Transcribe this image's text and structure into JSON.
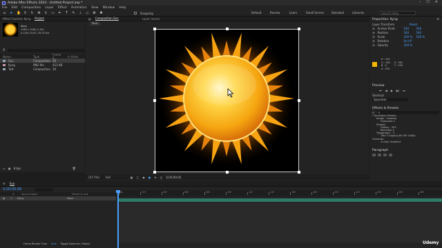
{
  "app": {
    "title": "Adobe After Effects 2024 - Untitled Project.aep *",
    "window_controls": [
      "–",
      "☐",
      "✕"
    ]
  },
  "menu": [
    "File",
    "Edit",
    "Composition",
    "Layer",
    "Effect",
    "Animation",
    "View",
    "Window",
    "Help"
  ],
  "workspaces": [
    "Default",
    "Review",
    "Learn",
    "Small Screen",
    "Standard",
    "Libraries"
  ],
  "search_placeholder": "Search Help",
  "left_panel": {
    "tabs": [
      "Effect Controls Kyng",
      "Project"
    ],
    "footage": {
      "name": "Kyng",
      "line1": "1080 x 1080 (1.00)",
      "line2": "Δ 0;00;10;00, 30.00 fps"
    },
    "search": "",
    "columns": [
      "Name",
      "Type",
      "Frame R...",
      "In Point"
    ],
    "items": [
      {
        "name": "Sun",
        "type": "Composition",
        "fps": "30"
      },
      {
        "name": "Kyng",
        "type": "PNG file",
        "fps": "422 KB"
      },
      {
        "name": "Test",
        "type": "Composition",
        "fps": "30"
      }
    ],
    "footer_bpc": "8 bpc"
  },
  "comp_panel": {
    "tabs": [
      "Composition Sun",
      "Layer (none)"
    ],
    "breadcrumb": "Sun",
    "zoom": "(37.7%)",
    "resolution": "Full",
    "timecode": "0;00;00;00"
  },
  "right_panel": {
    "properties_title": "Properties: Kyng",
    "layer_transform": "Layer Transform",
    "reset": "Reset",
    "transform": [
      {
        "label": "Anchor Point",
        "v1": "540",
        "v2": "540"
      },
      {
        "label": "Position",
        "v1": "540",
        "v2": "540"
      },
      {
        "label": "Scale",
        "v1": "100 %",
        "v2": "100 %"
      },
      {
        "label": "Rotation",
        "v1": "0x+0°",
        "v2": ""
      },
      {
        "label": "Opacity",
        "v1": "100 %",
        "v2": ""
      }
    ],
    "info": {
      "r": "R : 244",
      "g": "G : 185",
      "b": "B : 0",
      "a": "A : 255",
      "x": "X : 561",
      "y": "Y : 549"
    },
    "preview_title": "Preview",
    "shortcut_label": "Shortcut",
    "shortcut_value": "Spacebar",
    "effects_title": "Effects & Presets",
    "effects_search": "s",
    "effects": [
      "* Animation Presets",
      "Image - Creative",
      "Grayscale 4",
      "Shapes",
      "Gallery - 303",
      "Backdrop 4",
      "Typography - 3",
      "Title 3 Looping BG SM 1080p",
      "Generate",
      "4-Color Gradient"
    ],
    "paragraph_title": "Paragraph"
  },
  "timeline": {
    "tab": "Sun",
    "timecode": "0;00;00;00",
    "search": "",
    "columns": [
      "#",
      "Source Name",
      "Parent & Link"
    ],
    "layer": {
      "index": "1",
      "name": "Kyng",
      "parent": "None"
    },
    "ruler": [
      "0s",
      "02f",
      "04f",
      "06f",
      "08f",
      "10f",
      "12f",
      "14f",
      "16f",
      "18f",
      "20f",
      "22f",
      "24f",
      "26f",
      "28f"
    ],
    "footer": "Frame Render Time",
    "footer_time": "0ms",
    "footer2": "Toggle Switches / Modes"
  },
  "watermark": "Udemy"
}
